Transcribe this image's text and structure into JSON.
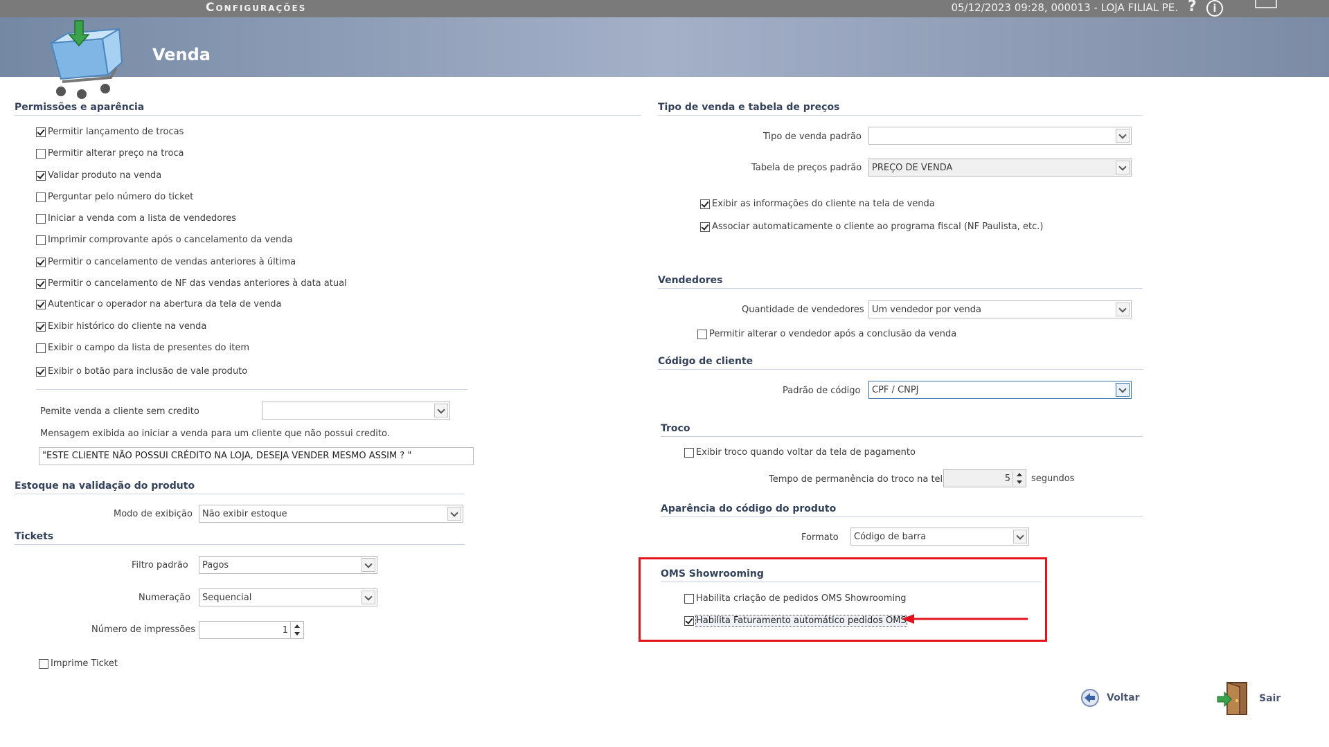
{
  "topbar": {
    "title": "Configurações",
    "info": "05/12/2023 09:28, 000013 - LOJA FILIAL PE.",
    "help": "?",
    "info_icon": "i"
  },
  "header": {
    "title": "Venda"
  },
  "left": {
    "permissoes": {
      "heading": "Permissões e aparência",
      "items": [
        {
          "label": "Permitir lançamento de trocas",
          "checked": true
        },
        {
          "label": "Permitir alterar preço na troca",
          "checked": false
        },
        {
          "label": "Validar produto na venda",
          "checked": true
        },
        {
          "label": "Perguntar pelo número do ticket",
          "checked": false
        },
        {
          "label": "Iniciar a venda com a lista de vendedores",
          "checked": false
        },
        {
          "label": "Imprimir comprovante após o cancelamento da venda",
          "checked": false
        },
        {
          "label": "Permitir o cancelamento de vendas anteriores à última",
          "checked": true
        },
        {
          "label": "Permitir o cancelamento de NF das vendas anteriores à data atual",
          "checked": true
        },
        {
          "label": "Autenticar o operador na abertura da tela de venda",
          "checked": true
        },
        {
          "label": "Exibir histórico do cliente na venda",
          "checked": true
        },
        {
          "label": "Exibir o campo da lista de presentes do item",
          "checked": false
        },
        {
          "label": "Exibir o botão para inclusão de vale produto",
          "checked": true
        }
      ],
      "sem_credito_label": "Pemite venda a cliente sem credito",
      "sem_credito_value": "",
      "mensagem_label": "Mensagem exibida ao iniciar a venda para um cliente que não possui credito.",
      "mensagem_value": "\"ESTE CLIENTE NÃO POSSUI CRÉDITO NA LOJA, DESEJA VENDER MESMO ASSIM ? \""
    },
    "estoque": {
      "heading": "Estoque na validação do produto",
      "modo_label": "Modo de exibição",
      "modo_value": "Não exibir estoque"
    },
    "tickets": {
      "heading": "Tickets",
      "filtro_label": "Filtro padrão",
      "filtro_value": "Pagos",
      "numeracao_label": "Numeração",
      "numeracao_value": "Sequencial",
      "impressoes_label": "Número de impressões",
      "impressoes_value": "1",
      "imprime_label": "Imprime Ticket",
      "imprime_checked": false
    }
  },
  "right": {
    "tipo": {
      "heading": "Tipo de venda e tabela de preços",
      "tipo_label": "Tipo de venda padrão",
      "tipo_value": "",
      "tabela_label": "Tabela de preços padrão",
      "tabela_value": "PREÇO DE VENDA",
      "cb1": {
        "label": "Exibir as informações do cliente na tela de venda",
        "checked": true
      },
      "cb2": {
        "label": "Associar automaticamente o cliente ao programa fiscal (NF Paulista, etc.)",
        "checked": true
      }
    },
    "vendedores": {
      "heading": "Vendedores",
      "qtd_label": "Quantidade de vendedores",
      "qtd_value": "Um vendedor por venda",
      "cb": {
        "label": "Permitir alterar o vendedor após a conclusão da venda",
        "checked": false
      }
    },
    "codigo_cliente": {
      "heading": "Código de cliente",
      "padrao_label": "Padrão de código",
      "padrao_value": "CPF / CNPJ"
    },
    "troco": {
      "heading": "Troco",
      "cb": {
        "label": "Exibir troco quando voltar da tela de pagamento",
        "checked": false
      },
      "tempo_label": "Tempo de permanência do troco na tela",
      "tempo_value": "5",
      "tempo_unit": "segundos"
    },
    "aparencia": {
      "heading": "Aparência do código do produto",
      "formato_label": "Formato",
      "formato_value": "Código de barra"
    },
    "oms": {
      "heading": "OMS Showrooming",
      "cb1": {
        "label": "Habilita criação de pedidos OMS Showrooming",
        "checked": false
      },
      "cb2": {
        "label": "Habilita Faturamento automático pedidos OMS",
        "checked": true
      }
    }
  },
  "footer": {
    "voltar": "Voltar",
    "sair": "Sair"
  },
  "colors": {
    "annotation": "#e3121c",
    "header": "#8c9bb6"
  }
}
